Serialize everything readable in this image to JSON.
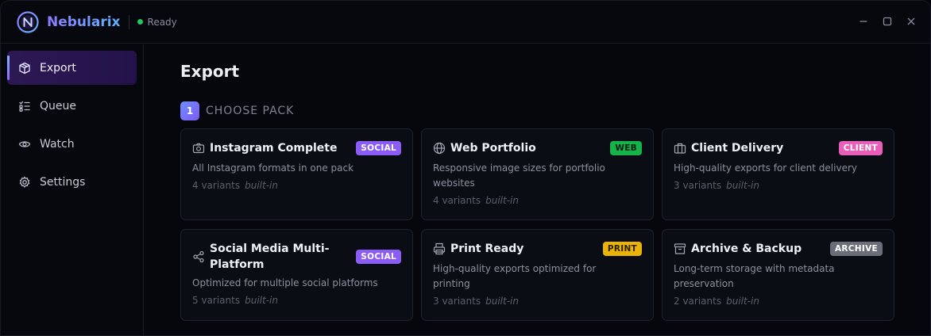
{
  "app": {
    "name": "Nebularix",
    "status": "Ready",
    "status_color": "#22c55e"
  },
  "window_controls": [
    "minimize-icon",
    "maximize-icon",
    "close-icon"
  ],
  "sidebar": {
    "items": [
      {
        "label": "Export",
        "icon": "package-icon",
        "active": true
      },
      {
        "label": "Queue",
        "icon": "checklist-icon",
        "active": false
      },
      {
        "label": "Watch",
        "icon": "eye-icon",
        "active": false
      },
      {
        "label": "Settings",
        "icon": "gear-icon",
        "active": false
      }
    ]
  },
  "main": {
    "title": "Export",
    "step": {
      "number": "1",
      "label": "CHOOSE PACK"
    },
    "packs": [
      {
        "title": "Instagram Complete",
        "icon": "camera-icon",
        "tag": "SOCIAL",
        "tag_bg": "#8b5cf6",
        "tag_fg": "#ffffff",
        "description": "All Instagram formats in one pack",
        "variants": "4 variants",
        "source": "built-in"
      },
      {
        "title": "Web Portfolio",
        "icon": "globe-icon",
        "tag": "WEB",
        "tag_bg": "#16b24b",
        "tag_fg": "#06220f",
        "description": "Responsive image sizes for portfolio websites",
        "variants": "4 variants",
        "source": "built-in"
      },
      {
        "title": "Client Delivery",
        "icon": "briefcase-icon",
        "tag": "CLIENT",
        "tag_bg": "#e85fb9",
        "tag_fg": "#ffffff",
        "description": "High-quality exports for client delivery",
        "variants": "3 variants",
        "source": "built-in"
      },
      {
        "title": "Social Media Multi-Platform",
        "icon": "share-icon",
        "tag": "SOCIAL",
        "tag_bg": "#8b5cf6",
        "tag_fg": "#ffffff",
        "description": "Optimized for multiple social platforms",
        "variants": "5 variants",
        "source": "built-in"
      },
      {
        "title": "Print Ready",
        "icon": "printer-icon",
        "tag": "PRINT",
        "tag_bg": "#eab308",
        "tag_fg": "#2a1f00",
        "description": "High-quality exports optimized for printing",
        "variants": "3 variants",
        "source": "built-in"
      },
      {
        "title": "Archive & Backup",
        "icon": "archive-icon",
        "tag": "ARCHIVE",
        "tag_bg": "#6b6e78",
        "tag_fg": "#ffffff",
        "description": "Long-term storage with metadata preservation",
        "variants": "2 variants",
        "source": "built-in"
      }
    ]
  }
}
